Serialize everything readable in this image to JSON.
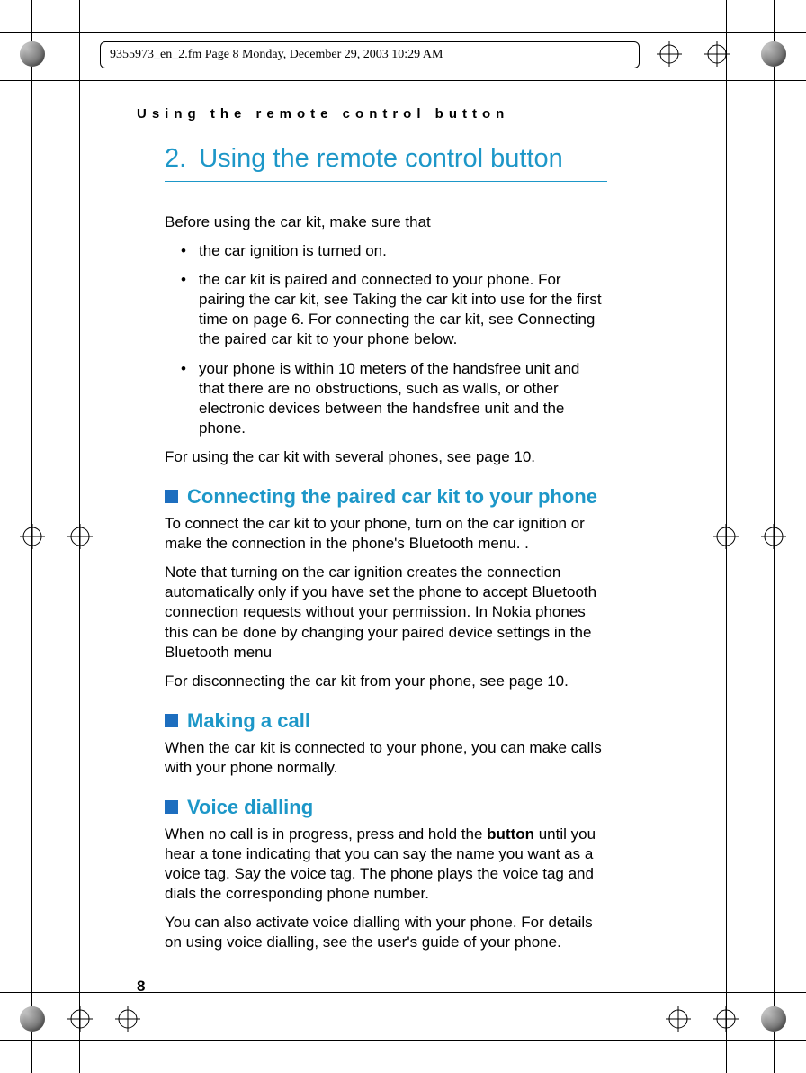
{
  "header": {
    "file_info": "9355973_en_2.fm  Page 8  Monday, December 29, 2003  10:29 AM"
  },
  "running_head": "Using the remote control button",
  "chapter": {
    "number": "2.",
    "title": "Using the remote control button"
  },
  "intro": "Before using the car kit, make sure that",
  "bullets": [
    "the car ignition is turned on.",
    "the car kit is paired and connected to your phone. For pairing the car kit, see Taking the car kit into use for the first time on page 6. For connecting the car kit, see Connecting the paired car kit to your phone below.",
    "your phone is within 10 meters of the handsfree unit and that there are no obstructions, such as walls, or other electronic devices between the handsfree unit and the phone."
  ],
  "intro_after": "For using the car kit with several phones, see page 10.",
  "sections": [
    {
      "title": "Connecting the paired car kit to your phone",
      "paras": [
        "To connect the car kit to your phone, turn on the car ignition or make the connection in the phone's Bluetooth menu. .",
        "Note that turning on the car ignition creates the connection automatically only if you have set the phone to accept Bluetooth connection requests without your permission. In Nokia phones this can be done by changing your paired device settings in the Bluetooth menu",
        "For disconnecting the car kit from your phone, see page 10."
      ]
    },
    {
      "title": "Making a call",
      "paras": [
        "When the car kit is connected to your phone, you can make calls with your phone normally."
      ]
    },
    {
      "title": "Voice dialling",
      "paras_mixed": {
        "p1_pre": "When no call is in progress, press and hold the ",
        "p1_bold": "button",
        "p1_post": " until you hear a tone indicating that you can say the name you want as a voice tag. Say the voice tag. The phone plays the voice tag and dials the corresponding phone number.",
        "p2": "You can also activate voice dialling with your phone. For details on using voice dialling, see the user's guide of your phone."
      }
    }
  ],
  "page_number": "8"
}
